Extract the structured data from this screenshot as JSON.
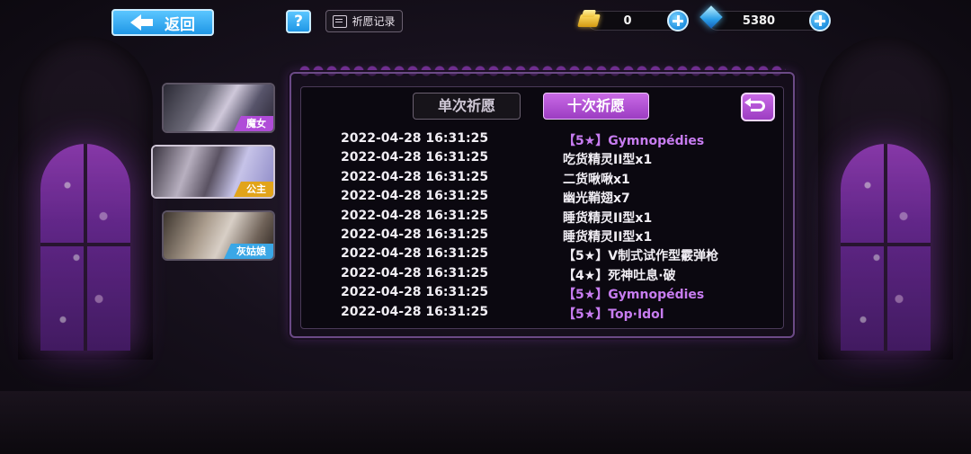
{
  "topbar": {
    "back_label": "返回",
    "help_label": "?",
    "record_label": "祈愿记录",
    "gold": {
      "icon": "gold-ticket-icon",
      "value": "0"
    },
    "gem": {
      "icon": "gem-icon",
      "value": "5380"
    }
  },
  "side_tabs": [
    {
      "label": "魔女",
      "color": "#b04cd8"
    },
    {
      "label": "公主",
      "color": "#e2a41a"
    },
    {
      "label": "灰姑娘",
      "color": "#3aa7e6"
    }
  ],
  "panel": {
    "tab_single": "单次祈愿",
    "tab_ten": "十次祈愿",
    "active_tab": "十次祈愿",
    "accent": "#b04cd8",
    "records": [
      {
        "time": "2022-04-28 16:31:25",
        "item": "【5★】Gymnopédies",
        "highlight": true
      },
      {
        "time": "2022-04-28 16:31:25",
        "item": "吃货精灵II型x1",
        "highlight": false
      },
      {
        "time": "2022-04-28 16:31:25",
        "item": "二货啾啾x1",
        "highlight": false
      },
      {
        "time": "2022-04-28 16:31:25",
        "item": "幽光鞘翅x7",
        "highlight": false
      },
      {
        "time": "2022-04-28 16:31:25",
        "item": "睡货精灵II型x1",
        "highlight": false
      },
      {
        "time": "2022-04-28 16:31:25",
        "item": "睡货精灵II型x1",
        "highlight": false
      },
      {
        "time": "2022-04-28 16:31:25",
        "item": "【5★】V制式试作型霰弹枪",
        "highlight": false
      },
      {
        "time": "2022-04-28 16:31:25",
        "item": "【4★】死神吐息·破",
        "highlight": false
      },
      {
        "time": "2022-04-28 16:31:25",
        "item": "【5★】Gymnopédies",
        "highlight": true
      },
      {
        "time": "2022-04-28 16:31:25",
        "item": "【5★】Top·Idol",
        "highlight": true
      }
    ]
  }
}
